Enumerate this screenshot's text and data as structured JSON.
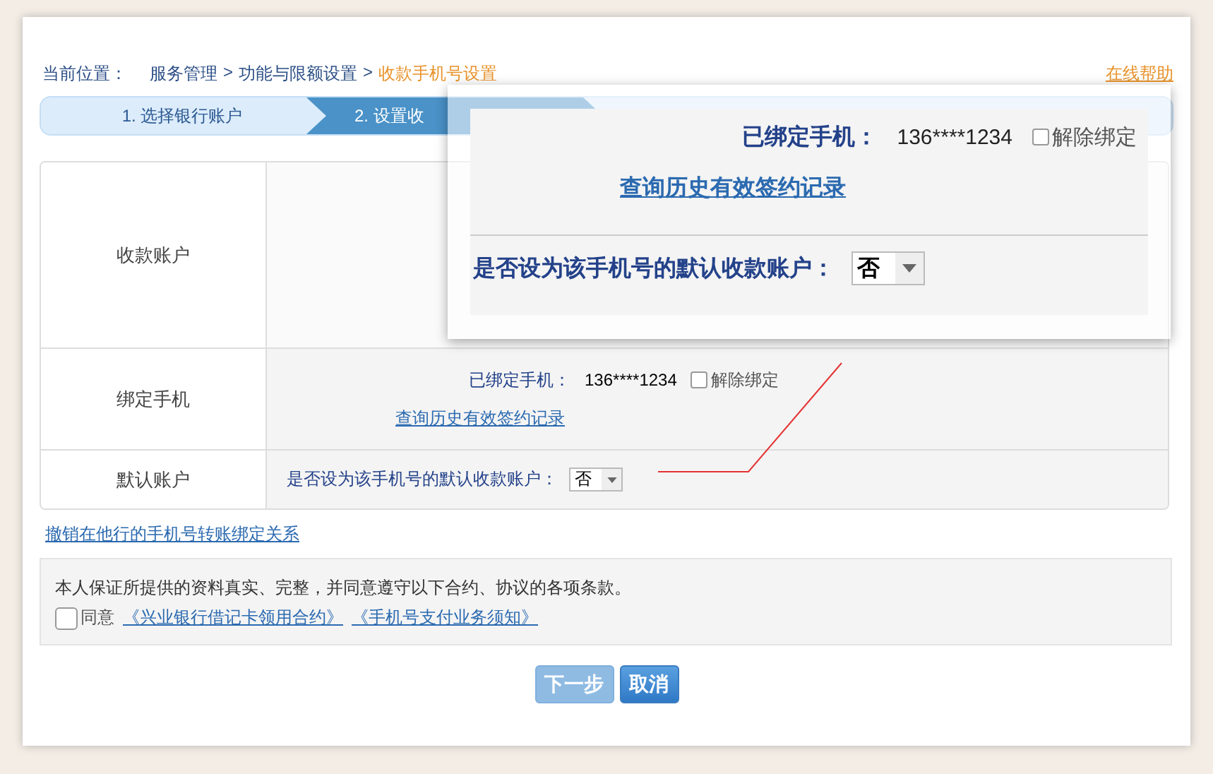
{
  "breadcrumb": {
    "label": "当前位置：",
    "separator": ">",
    "items": [
      {
        "text": "服务管理",
        "current": false
      },
      {
        "text": "功能与限额设置",
        "current": false
      },
      {
        "text": "收款手机号设置",
        "current": true
      }
    ]
  },
  "help_link": "在线帮助",
  "steps": [
    {
      "label": "1. 选择银行账户",
      "selected": false
    },
    {
      "label": "2. 设置收",
      "selected": true
    },
    {
      "selected": false
    }
  ],
  "form_rows": [
    {
      "kind": "account",
      "label": "收款账户"
    },
    {
      "kind": "phone",
      "label": "绑定手机",
      "phone_label": "已绑定手机：",
      "phone": "136****1234",
      "unbind": {
        "label": "解除绑定",
        "checked": false
      },
      "history_link": "查询历史有效签约记录"
    },
    {
      "kind": "default",
      "label": "默认账户",
      "question": "是否设为该手机号的默认收款账户：",
      "select_value": "否"
    }
  ],
  "revoke_link": "撤销在他行的手机号转账绑定关系",
  "agreement": {
    "statement": "本人保证所提供的资料真实、完整，并同意遵守以下合约、协议的各项条款。",
    "agree_label": "同意",
    "checked": false,
    "links": [
      "《兴业银行借记卡领用合约》",
      "《手机号支付业务须知》"
    ]
  },
  "buttons": [
    {
      "label": "下一步",
      "disabled": true
    },
    {
      "label": "取消",
      "disabled": false
    }
  ],
  "magnifier": {
    "phone_label": "已绑定手机：",
    "phone": "136****1234",
    "unbind": {
      "label": "解除绑定",
      "checked": false
    },
    "history_link": "查询历史有效签约记录",
    "question": "是否设为该手机号的默认收款账户：",
    "select_value": "否"
  }
}
